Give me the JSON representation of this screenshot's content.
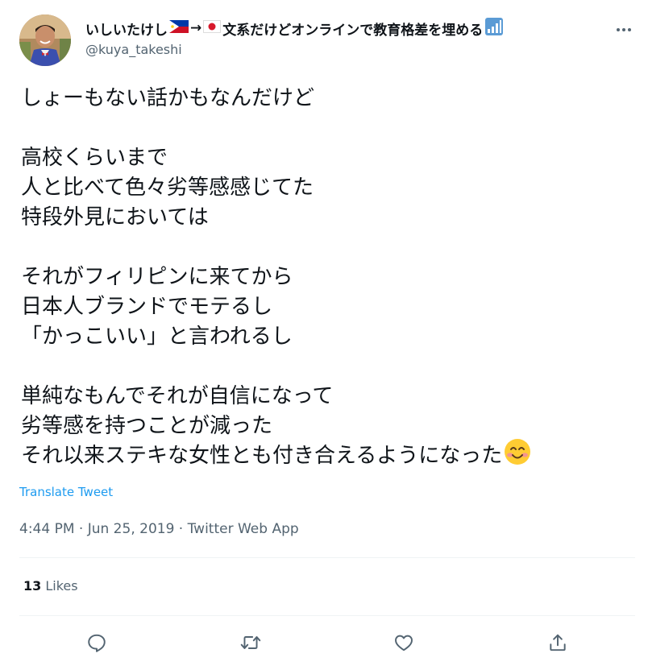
{
  "author": {
    "name_prefix": "いしいたけし",
    "arrow": "→",
    "name_suffix": "文系だけどオンラインで教育格差を埋める",
    "handle": "@kuya_takeshi"
  },
  "tweet": {
    "lines": [
      "しょーもない話かもなんだけど",
      "",
      "高校くらいまで",
      "人と比べて色々劣等感感じてた",
      "特段外見においては",
      "",
      "それがフィリピンに来てから",
      "日本人ブランドでモテるし",
      "「かっこいい」と言われるし",
      "",
      "単純なもんでそれが自信になって",
      "劣等感を持つことが減った",
      "それ以来ステキな女性とも付き合えるようになった"
    ],
    "translate_label": "Translate Tweet",
    "time": "4:44 PM",
    "date": "Jun 25, 2019",
    "source": "Twitter Web App",
    "separator": " · "
  },
  "stats": {
    "likes_count": "13",
    "likes_label": "Likes"
  },
  "colors": {
    "text": "#0f1419",
    "secondary": "#536471",
    "link": "#1d9bf0",
    "divider": "#eff3f4"
  },
  "icons": {
    "flag_left": "philippines-flag-icon",
    "flag_right": "japan-flag-icon",
    "badge": "signal-bars-icon",
    "emoji": "smiling-face-icon",
    "more": "more-icon",
    "reply": "reply-icon",
    "retweet": "retweet-icon",
    "like": "heart-icon",
    "share": "share-icon"
  }
}
